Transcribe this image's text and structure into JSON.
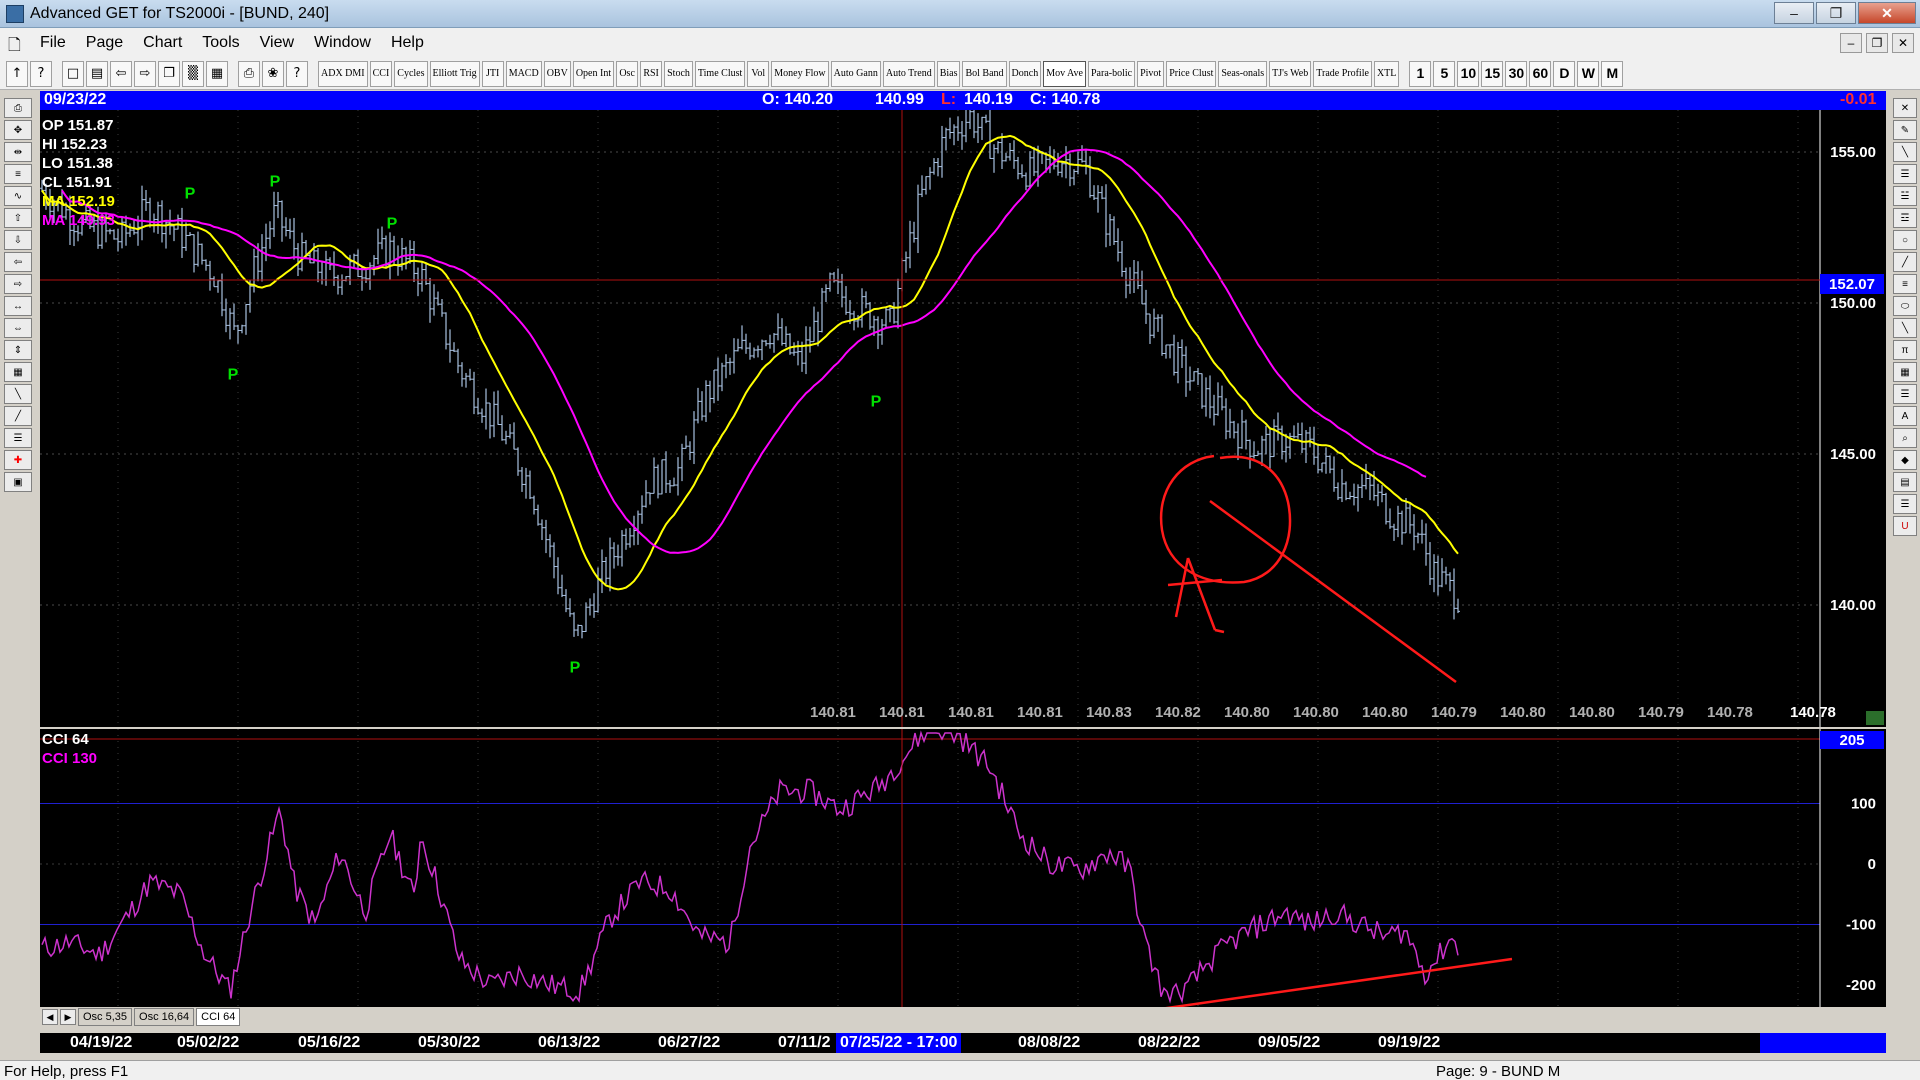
{
  "window": {
    "title": "Advanced GET for TS2000i - [BUND, 240]",
    "controls": {
      "minimize": "–",
      "restore": "❐",
      "close": "✕"
    }
  },
  "menu": {
    "items": [
      "File",
      "Page",
      "Chart",
      "Tools",
      "View",
      "Window",
      "Help"
    ]
  },
  "toolbar": {
    "study_buttons": [
      "ADX DMI",
      "CCI",
      "Cycles",
      "Elliott Trig",
      "JTI",
      "MACD",
      "OBV",
      "Open Int",
      "Osc",
      "RSI",
      "Stoch",
      "Time Clust",
      "Vol",
      "Money Flow",
      "Auto Gann",
      "Auto Trend",
      "Bias",
      "Bol Band",
      "Donch",
      "Mov Ave",
      "Para-bolic",
      "Pivot",
      "Price Clust",
      "Seas-onals",
      "TJ's Web",
      "Trade Profile",
      "XTL"
    ],
    "timeframes": [
      "1",
      "5",
      "10",
      "15",
      "30",
      "60",
      "D",
      "W",
      "M"
    ]
  },
  "infobar": {
    "date": "09/23/22",
    "open": "O: 140.20",
    "high": "140.99",
    "low_label": "L:",
    "low": "140.19",
    "close": "C: 140.78",
    "change": "-0.01"
  },
  "legend": {
    "op": "OP  151.87",
    "hi": "HI   152.23",
    "lo": "LO  151.38",
    "cl": "CL  151.91",
    "ma1": "MA  152.19",
    "ma2": "MA  149.93"
  },
  "price_axis": {
    "ticks": [
      "155.00",
      "150.00",
      "145.00",
      "140.00"
    ],
    "cursor_price": "152.07"
  },
  "bottom_values": [
    "140.81",
    "140.81",
    "140.81",
    "140.81",
    "140.83",
    "140.82",
    "140.80",
    "140.80",
    "140.80",
    "140.79",
    "140.80",
    "140.80",
    "140.79",
    "140.78"
  ],
  "last_value": "140.78",
  "pivot_label": "P",
  "annotation_letter": "A",
  "cci": {
    "title1": "CCI 64",
    "title2": "CCI  130",
    "ticks": [
      "100",
      "0",
      "-100",
      "-200"
    ],
    "current": "205"
  },
  "osc_tabs": [
    "Osc 5,35",
    "Osc 16,64",
    "CCI 64"
  ],
  "dates": [
    "04/19/22",
    "05/02/22",
    "05/16/22",
    "05/30/22",
    "06/13/22",
    "06/27/22",
    "07/11/2",
    "08/08/22",
    "08/22/22",
    "09/05/22",
    "09/19/22"
  ],
  "cursor_date": "07/25/22 - 17:00",
  "status": {
    "help": "For Help, press F1",
    "page": "Page: 9 - BUND M"
  },
  "colors": {
    "ma_fast": "#ffff00",
    "ma_slow": "#ff00ff",
    "bars": "#a8c0e0",
    "drawing": "#ff1a1a",
    "pivot": "#00ff00",
    "cci": "#cc33cc"
  }
}
